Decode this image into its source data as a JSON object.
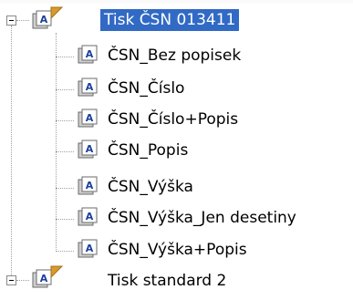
{
  "tree": {
    "root1": {
      "label": "Tisk ČSN 013411",
      "selected": true,
      "children": [
        "ČSN_Bez popisek",
        "ČSN_Číslo",
        "ČSN_Číslo+Popis",
        "ČSN_Popis",
        "ČSN_Výška",
        "ČSN_Výška_Jen desetiny",
        "ČSN_Výška+Popis"
      ]
    },
    "root2": {
      "label": "Tisk standard 2"
    }
  },
  "colors": {
    "selection": "#316ac5",
    "selection_text": "#ffffff",
    "tree_lines": "#a0a0a0",
    "flag": "#d89a2a"
  },
  "icons": {
    "node": "style-sheet-icon",
    "flag": "orange-flag-icon",
    "expander": "collapse-minus-icon"
  }
}
